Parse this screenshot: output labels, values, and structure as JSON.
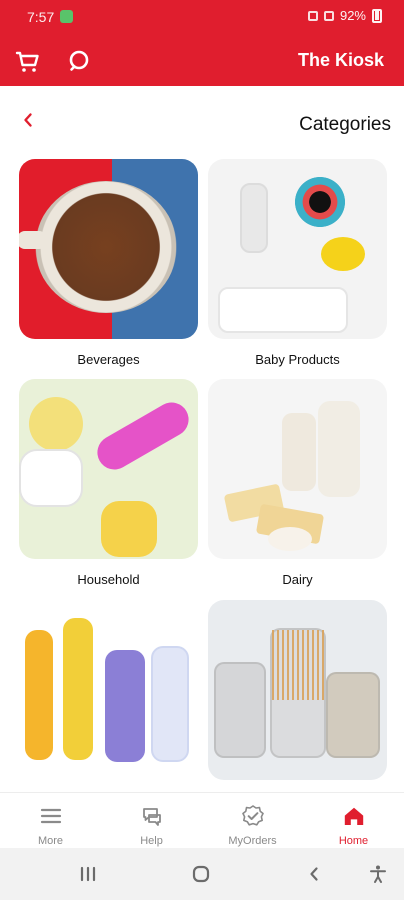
{
  "status_bar": {
    "time": "7:57",
    "right_text": "92%"
  },
  "app_bar": {
    "brand": "The Kiosk",
    "icons": [
      "cart-icon",
      "search-icon"
    ]
  },
  "title_bar": {
    "title": "Categories",
    "back_icon": "chevron-left-icon"
  },
  "categories": [
    {
      "label": "Beverages"
    },
    {
      "label": "Baby Products"
    },
    {
      "label": "Household"
    },
    {
      "label": "Dairy"
    },
    {
      "label": ""
    },
    {
      "label": ""
    }
  ],
  "bottom_nav": {
    "items": [
      {
        "label": "More",
        "icon": "menu-icon",
        "active": false
      },
      {
        "label": "Help",
        "icon": "chat-icon",
        "active": false
      },
      {
        "label": "MyOrders",
        "icon": "badge-check-icon",
        "active": false
      },
      {
        "label": "Home",
        "icon": "home-icon",
        "active": true
      }
    ]
  },
  "system_nav": {
    "icons": [
      "recent-apps-icon",
      "home-circle-icon",
      "back-icon",
      "accessibility-icon"
    ]
  },
  "colors": {
    "brand_red": "#e01e2e",
    "nav_inactive": "#8a8a8a"
  }
}
